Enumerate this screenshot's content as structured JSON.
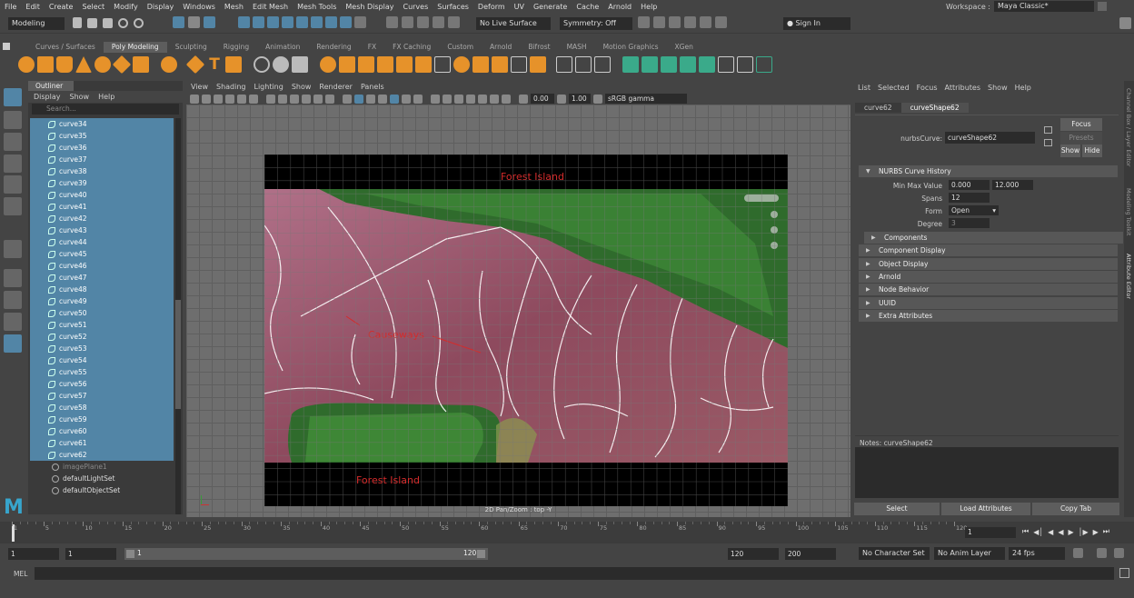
{
  "menus": [
    "File",
    "Edit",
    "Create",
    "Select",
    "Modify",
    "Display",
    "Windows",
    "Mesh",
    "Edit Mesh",
    "Mesh Tools",
    "Mesh Display",
    "Curves",
    "Surfaces",
    "Deform",
    "UV",
    "Generate",
    "Cache",
    "Arnold",
    "Help"
  ],
  "workspace": {
    "label": "Workspace :",
    "value": "Maya Classic*"
  },
  "status": {
    "mode": "Modeling",
    "live_surface": "No Live Surface",
    "symmetry": "Symmetry: Off",
    "sign_in": "Sign In"
  },
  "shelf_tabs": [
    "Curves / Surfaces",
    "Poly Modeling",
    "Sculpting",
    "Rigging",
    "Animation",
    "Rendering",
    "FX",
    "FX Caching",
    "Custom",
    "Arnold",
    "Bifrost",
    "MASH",
    "Motion Graphics",
    "XGen"
  ],
  "shelf_active": "Poly Modeling",
  "outliner": {
    "title": "Outliner",
    "menu": [
      "Display",
      "Show",
      "Help"
    ],
    "search_placeholder": "Search...",
    "curves": [
      "curve34",
      "curve35",
      "curve36",
      "curve37",
      "curve38",
      "curve39",
      "curve40",
      "curve41",
      "curve42",
      "curve43",
      "curve44",
      "curve45",
      "curve46",
      "curve47",
      "curve48",
      "curve49",
      "curve50",
      "curve51",
      "curve52",
      "curve53",
      "curve54",
      "curve55",
      "curve56",
      "curve57",
      "curve58",
      "curve59",
      "curve60",
      "curve61",
      "curve62"
    ],
    "others": [
      "imagePlane1",
      "defaultLightSet",
      "defaultObjectSet"
    ]
  },
  "viewport": {
    "menu": [
      "View",
      "Shading",
      "Lighting",
      "Show",
      "Renderer",
      "Panels"
    ],
    "exposure": "0.00",
    "gamma": "1.00",
    "colorspace": "sRGB gamma",
    "label": "2D Pan/Zoom : top -Y",
    "annotations": {
      "top": "Forest Island",
      "middle": "Causeways",
      "bottom": "Forest Island"
    }
  },
  "attribute_editor": {
    "menu": [
      "List",
      "Selected",
      "Focus",
      "Attributes",
      "Show",
      "Help"
    ],
    "tabs": [
      "curve62",
      "curveShape62"
    ],
    "active_tab": "curveShape62",
    "node_label": "nurbsCurve:",
    "node_value": "curveShape62",
    "buttons": {
      "focus": "Focus",
      "presets": "Presets",
      "show": "Show",
      "hide": "Hide"
    },
    "history_section": "NURBS Curve History",
    "fields": {
      "min_max_label": "Min Max Value",
      "min": "0.000",
      "max": "12.000",
      "spans_label": "Spans",
      "spans": "12",
      "form_label": "Form",
      "form": "Open",
      "degree_label": "Degree",
      "degree": "3"
    },
    "sections": [
      "Components",
      "Component Display",
      "Object Display",
      "Arnold",
      "Node Behavior",
      "UUID",
      "Extra Attributes"
    ],
    "notes_label": "Notes:  curveShape62",
    "bottom_buttons": [
      "Select",
      "Load Attributes",
      "Copy Tab"
    ],
    "side_tabs": [
      "Channel Box / Layer Editor",
      "Modeling Toolkit",
      "Attribute Editor"
    ]
  },
  "timeline": {
    "ticks": [
      "1",
      "5",
      "10",
      "15",
      "20",
      "25",
      "30",
      "35",
      "40",
      "45",
      "50",
      "55",
      "60",
      "65",
      "70",
      "75",
      "80",
      "85",
      "90",
      "95",
      "100",
      "105",
      "110",
      "115",
      "120"
    ],
    "current_frame": "1"
  },
  "range": {
    "start": "1",
    "playback_start": "1",
    "slider_start": "1",
    "slider_end": "120",
    "playback_end": "120",
    "end": "200",
    "character_set": "No Character Set",
    "anim_layer": "No Anim Layer",
    "fps": "24 fps"
  },
  "command": {
    "label": "MEL"
  }
}
